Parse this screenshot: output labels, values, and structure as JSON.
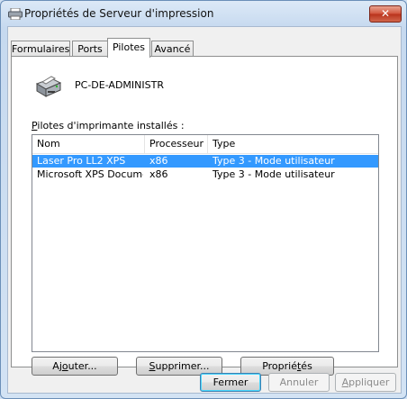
{
  "window": {
    "title": "Propriétés de Serveur d'impression",
    "close_glyph": "✕"
  },
  "tabs": [
    {
      "label": "Formulaires",
      "active": false
    },
    {
      "label": "Ports",
      "active": false
    },
    {
      "label": "Pilotes",
      "active": true
    },
    {
      "label": "Avancé",
      "active": false
    }
  ],
  "server": {
    "name": "PC-DE-ADMINISTR",
    "icon": "printer-server-icon"
  },
  "drivers": {
    "label_hotkey": "P",
    "label_rest": "ilotes d'imprimante installés :",
    "columns": [
      "Nom",
      "Processeur",
      "Type"
    ],
    "rows": [
      {
        "name": "Laser Pro LL2 XPS",
        "processor": "x86",
        "type": "Type 3 - Mode utilisateur",
        "selected": true
      },
      {
        "name": "Microsoft XPS Documen...",
        "processor": "x86",
        "type": "Type 3 - Mode utilisateur",
        "selected": false
      }
    ],
    "selection_color": "#3399ff"
  },
  "actions": {
    "add_pre": "Aj",
    "add_key": "o",
    "add_post": "uter...",
    "remove_key": "S",
    "remove_post": "upprimer...",
    "props_pre": "Proprié",
    "props_key": "t",
    "props_post": "és"
  },
  "footer": {
    "ok": "Fermer",
    "cancel": "Annuler",
    "apply_key": "A",
    "apply_post": "ppliquer"
  }
}
